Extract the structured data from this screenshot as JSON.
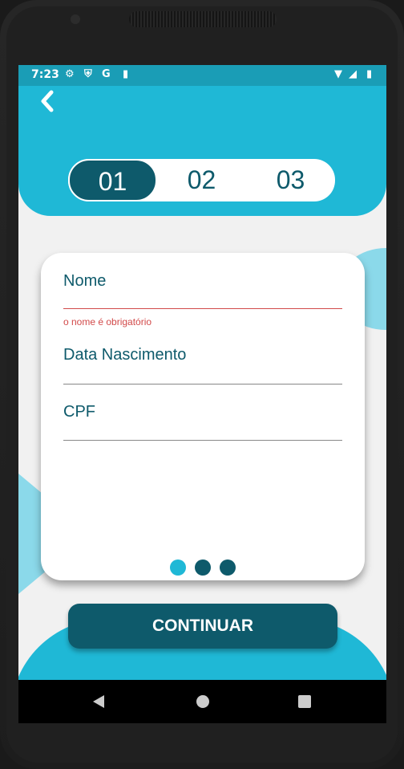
{
  "status_bar": {
    "time": "7:23",
    "icons": [
      "settings-icon",
      "shield-icon",
      "google-icon",
      "sd-card-icon",
      "wifi-icon",
      "signal-icon",
      "battery-icon"
    ]
  },
  "stepper": {
    "steps": [
      "01",
      "02",
      "03"
    ],
    "active_index": 0
  },
  "form": {
    "fields": [
      {
        "label": "Nome",
        "error": "o nome é obrigatório"
      },
      {
        "label": "Data Nascimento"
      },
      {
        "label": "CPF"
      }
    ]
  },
  "pager": {
    "count": 3,
    "active_index": 0
  },
  "cta": {
    "label": "CONTINUAR"
  },
  "colors": {
    "primary": "#1fb8d6",
    "dark": "#0e5a6b",
    "error": "#d24a4a"
  }
}
